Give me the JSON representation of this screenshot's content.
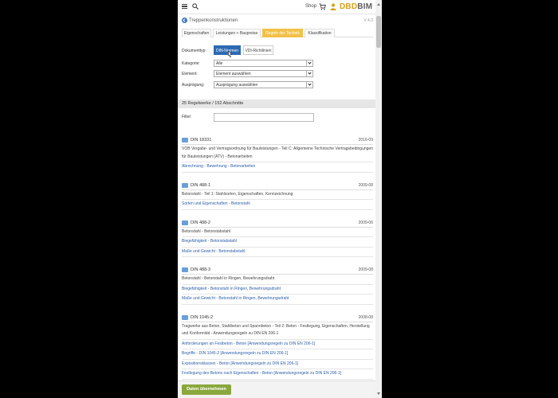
{
  "topbar": {
    "shop_label": "Shop",
    "logo_part1": "DBD",
    "logo_part2": "BIM"
  },
  "header": {
    "title": "Treppenkonstruktionen",
    "version": "V 4.0"
  },
  "tabs": [
    {
      "label": "Eigenschaften"
    },
    {
      "label": "Leistungen + Baupreise"
    },
    {
      "label": "Regeln der Technik"
    },
    {
      "label": "Klassifikation"
    }
  ],
  "form": {
    "doctype_label": "Dokumenttyp:",
    "doctype_options": [
      "DIN-Normen",
      "VDI-Richtlinien"
    ],
    "category_label": "Kategorie:",
    "category_value": "Alle",
    "element_label": "Element:",
    "element_value": "Element auswählen",
    "variant_label": "Ausprägung:",
    "variant_value": "Ausprägung auswählen"
  },
  "count_text": "25 Regelwerke / 152 Abschnitte",
  "filter_label": "Filter:",
  "entries": [
    {
      "code": "DIN 18331",
      "date": "2016-09",
      "description": "VOB Vergabe- und Vertragsordnung für Bauleistungen - Teil C: Allgemeine Technische Vertragsbedingungen für Bauleistungen (ATV) - Betonarbeiten",
      "links": [
        "Abrechnung - Bewehrung - Betonarbeiten"
      ]
    },
    {
      "code": "DIN 488-1",
      "date": "2009-08",
      "description": "Betonstahl - Teil 1: Stahlsorten, Eigenschaften, Kennzeichnung",
      "links": [
        "Sorten und Eigenschaften - Betonstahl"
      ]
    },
    {
      "code": "DIN 488-2",
      "date": "2009-06",
      "description": "Betonstahl - Betonstabstahl",
      "links": [
        "Biegefähigkeit - Betonstabstahl",
        "Maße und Gewicht - Betonstabstahl"
      ]
    },
    {
      "code": "DIN 488-3",
      "date": "2009-08",
      "description": "Betonstahl - Betonstahl in Ringen, Bewehrungsdraht",
      "links": [
        "Biegefähigkeit - Betonstahl in Ringen, Bewehrungsdraht",
        "Maße und Gewicht - Betonstahl in Ringen, Bewehrungsdraht"
      ]
    },
    {
      "code": "DIN 1045-2",
      "date": "2008-08",
      "description": "Tragwerke aus Beton, Stahlbeton und Spannbeton - Teil 2: Beton - Festlegung, Eigenschaften, Herstellung und Konformität - Anwendungsregeln zu DIN EN 206-1",
      "links": [
        "Anforderungen an Festbeton - Beton [Anwendungsregeln zu DIN EN 206-1]",
        "Begriffe - DIN 1045-2 [Anwendungsregeln zu DIN EN 206-1]",
        "Expositionsklassen - Beton [Anwendungsregeln zu DIN EN 206-1]",
        "Festlegung des Betons nach Eigenschaften - Beton [Anwendungsregeln zu DIN EN 206-1]"
      ]
    }
  ],
  "footer": {
    "submit_label": "Daten übernehmen"
  },
  "colors": {
    "accent_yellow": "#f2c14a",
    "primary_blue": "#2e6ab3",
    "link_blue": "#2b5ea8",
    "submit_green": "#8aa73d"
  }
}
